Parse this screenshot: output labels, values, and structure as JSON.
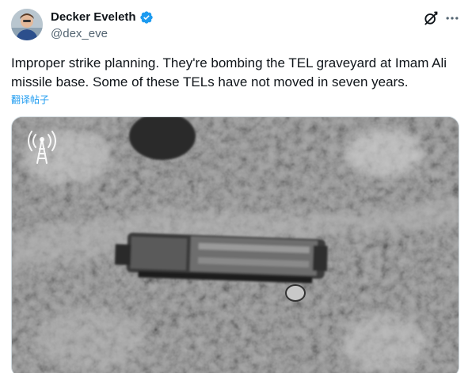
{
  "author": {
    "display_name": "Decker Eveleth",
    "handle": "@dex_eve",
    "verified": true,
    "avatar_icon": "user-avatar"
  },
  "actions": {
    "grok_icon": "grok-icon",
    "more_icon": "more-dots-icon"
  },
  "tweet": {
    "text": "Improper strike planning. They're bombing the TEL graveyard at Imam Ali missile base. Some of these TELs have not moved in seven years.",
    "translate_label": "翻译帖子"
  },
  "media": {
    "type": "grayscale aerial video still",
    "watermark_icon": "antenna-tower-icon"
  },
  "colors": {
    "text": "#0f1419",
    "secondary": "#536471",
    "link": "#1d9bf0",
    "verified": "#1d9bf0",
    "border": "#cfd9de"
  }
}
